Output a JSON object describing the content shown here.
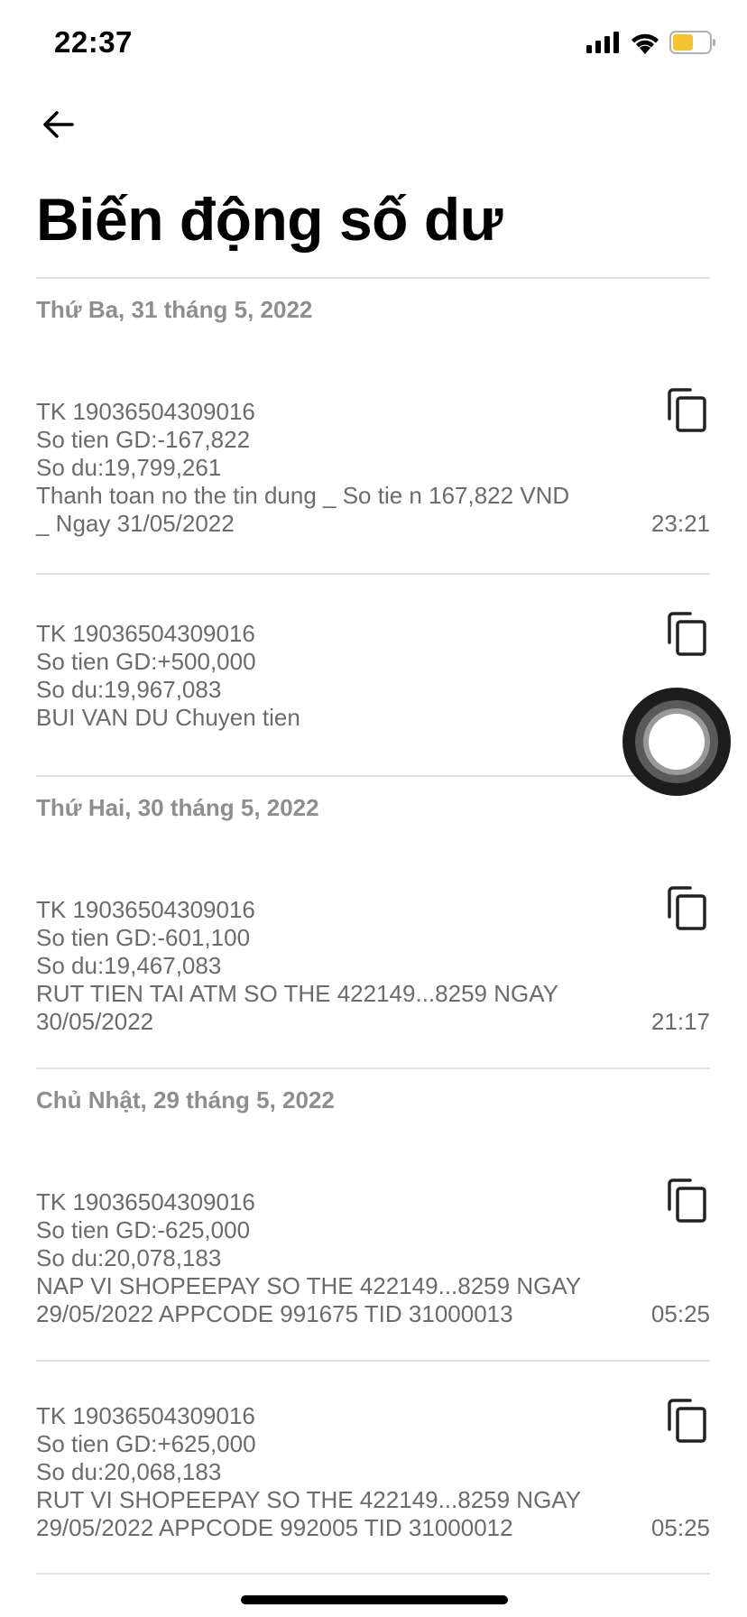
{
  "status_bar": {
    "time": "22:37"
  },
  "header": {
    "title": "Biến động số dư"
  },
  "groups": [
    {
      "date": "Thứ Ba, 31 tháng 5, 2022",
      "transactions": [
        {
          "lines": [
            "TK 19036504309016",
            "So tien GD:-167,822",
            "So du:19,799,261",
            "Thanh toan no the tin dung _ So tie n 167,822 VND",
            "_ Ngay 31/05/2022"
          ],
          "time": "23:21"
        },
        {
          "lines": [
            "TK 19036504309016",
            "So tien GD:+500,000",
            "So du:19,967,083",
            "BUI VAN DU Chuyen tien"
          ],
          "time": ""
        }
      ]
    },
    {
      "date": "Thứ Hai, 30 tháng 5, 2022",
      "transactions": [
        {
          "lines": [
            "TK 19036504309016",
            "So tien GD:-601,100",
            "So du:19,467,083",
            "RUT TIEN TAI ATM SO THE 422149...8259 NGAY",
            "30/05/2022"
          ],
          "time": "21:17"
        }
      ]
    },
    {
      "date": "Chủ Nhật, 29 tháng 5, 2022",
      "transactions": [
        {
          "lines": [
            "TK 19036504309016",
            "So tien GD:-625,000",
            "So du:20,078,183",
            "NAP VI SHOPEEPAY SO THE 422149...8259 NGAY",
            "29/05/2022 APPCODE 991675 TID 31000013"
          ],
          "time": "05:25"
        },
        {
          "lines": [
            "TK 19036504309016",
            "So tien GD:+625,000",
            "So du:20,068,183",
            "RUT VI SHOPEEPAY SO THE 422149...8259 NGAY",
            "29/05/2022 APPCODE 992005 TID 31000012"
          ],
          "time": "05:25"
        }
      ]
    }
  ]
}
